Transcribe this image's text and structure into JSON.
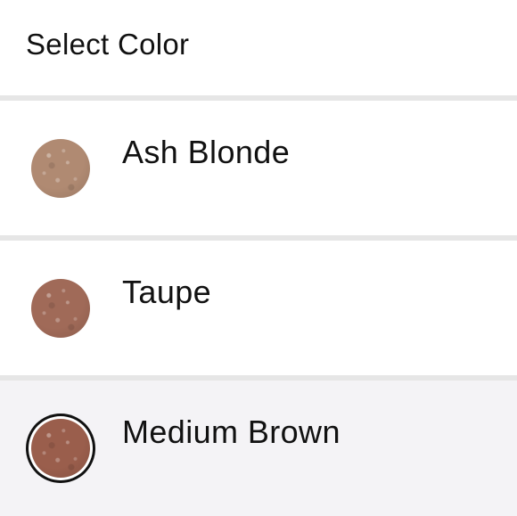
{
  "header": {
    "title": "Select Color"
  },
  "colors": [
    {
      "label": "Ash Blonde",
      "swatch": "#b08a72",
      "selected": false
    },
    {
      "label": "Taupe",
      "swatch": "#a06a58",
      "selected": false
    },
    {
      "label": "Medium Brown",
      "swatch": "#9a5e4c",
      "selected": true
    }
  ],
  "theme": {
    "divider": "#e6e6e6",
    "selected_row_bg": "#f4f3f6",
    "selected_ring": "#111111"
  }
}
